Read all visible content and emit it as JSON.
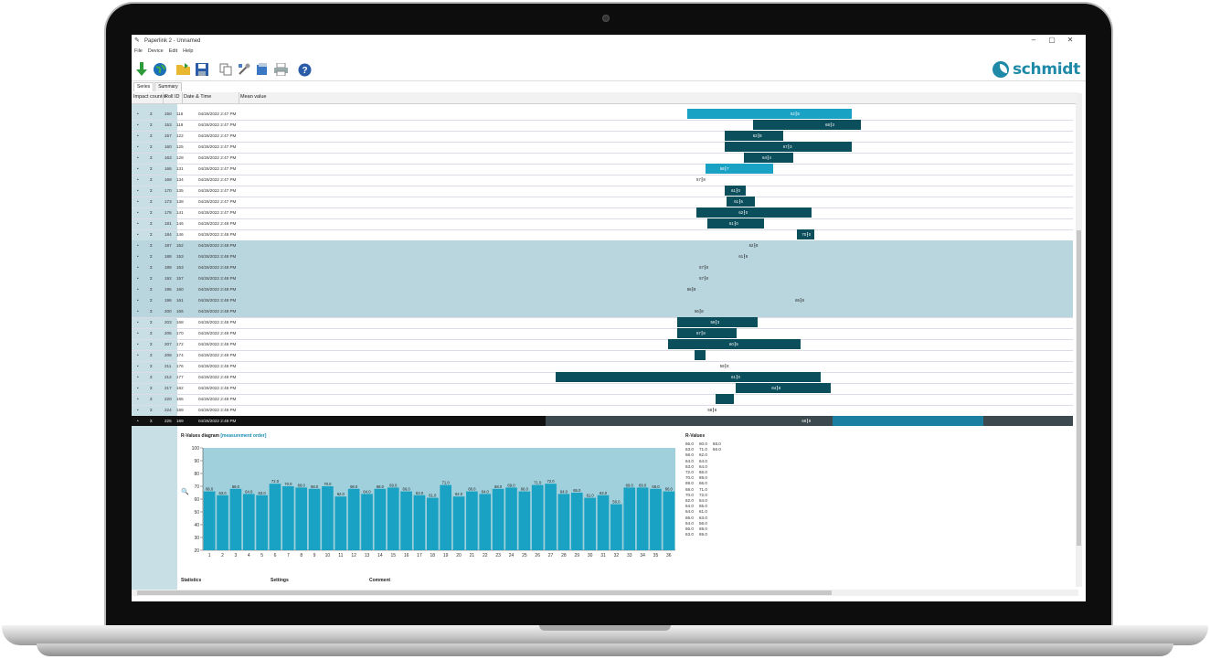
{
  "window": {
    "title": "Paperlink 2 - Unnamed",
    "controls": [
      "–",
      "▢",
      "✕"
    ]
  },
  "menu": [
    "File",
    "Device",
    "Edit",
    "Help"
  ],
  "toolbar_icons": [
    "download-icon",
    "globe-icon",
    "open-folder-icon",
    "save-icon",
    "copy-icon",
    "settings-tools-icon",
    "export-icon",
    "print-icon",
    "help-icon"
  ],
  "brand": {
    "name": "schmidt",
    "color": "#1e8aa8"
  },
  "tabs": [
    "Series",
    "Summary"
  ],
  "columns": [
    "Impact counter",
    "Roll ID",
    "Date & Time",
    "Mean value"
  ],
  "rows": [
    {
      "a": "150",
      "b": "115",
      "dt": "04/26/2022 2:47 PM",
      "bars": [
        {
          "from": 0.59,
          "to": 0.765,
          "tone": "light"
        }
      ],
      "mk": "62.8",
      "mkpos": 0.7
    },
    {
      "a": "153",
      "b": "118",
      "dt": "04/26/2022 2:47 PM",
      "bars": [
        {
          "from": 0.66,
          "to": 0.775,
          "tone": "dark"
        }
      ],
      "mk": "68.3",
      "mkpos": 0.737
    },
    {
      "a": "157",
      "b": "122",
      "dt": "04/26/2022 2:47 PM",
      "bars": [
        {
          "from": 0.63,
          "to": 0.692,
          "tone": "dark"
        }
      ],
      "mk": "62.8",
      "mkpos": 0.66
    },
    {
      "a": "160",
      "b": "125",
      "dt": "04/26/2022 2:47 PM",
      "bars": [
        {
          "from": 0.63,
          "to": 0.765,
          "tone": "dark"
        }
      ],
      "mk": "67.3",
      "mkpos": 0.692
    },
    {
      "a": "163",
      "b": "128",
      "dt": "04/26/2022 2:47 PM",
      "bars": [
        {
          "from": 0.65,
          "to": 0.703,
          "tone": "dark"
        }
      ],
      "mk": "64.4",
      "mkpos": 0.67
    },
    {
      "a": "166",
      "b": "131",
      "dt": "04/26/2022 2:47 PM",
      "bars": [
        {
          "from": 0.61,
          "to": 0.682,
          "tone": "light"
        }
      ],
      "mk": "58.7",
      "mkpos": 0.625
    },
    {
      "a": "169",
      "b": "134",
      "dt": "04/26/2022 2:47 PM",
      "bars": [],
      "mk": "57.8",
      "mkpos": 0.6
    },
    {
      "a": "170",
      "b": "135",
      "dt": "04/26/2022 2:47 PM",
      "bars": [
        {
          "from": 0.63,
          "to": 0.652,
          "tone": "dark"
        }
      ],
      "mk": "61.0",
      "mkpos": 0.637
    },
    {
      "a": "173",
      "b": "138",
      "dt": "04/26/2022 2:47 PM",
      "bars": [
        {
          "from": 0.632,
          "to": 0.662,
          "tone": "dark"
        }
      ],
      "mk": "61.5",
      "mkpos": 0.64
    },
    {
      "a": "176",
      "b": "141",
      "dt": "04/26/2022 2:47 PM",
      "bars": [
        {
          "from": 0.6,
          "to": 0.722,
          "tone": "dark"
        }
      ],
      "mk": "62.0",
      "mkpos": 0.645
    },
    {
      "a": "181",
      "b": "146",
      "dt": "04/26/2022 2:48 PM",
      "bars": [
        {
          "from": 0.612,
          "to": 0.672,
          "tone": "dark"
        }
      ],
      "mk": "61.0",
      "mkpos": 0.635
    },
    {
      "a": "184",
      "b": "146",
      "dt": "04/26/2022 2:48 PM",
      "bars": [
        {
          "from": 0.707,
          "to": 0.725,
          "tone": "dark"
        }
      ],
      "mk": "70.0",
      "mkpos": 0.712
    },
    {
      "a": "187",
      "b": "152",
      "dt": "04/26/2022 2:48 PM",
      "bars": [],
      "mk": "62.8",
      "mkpos": 0.656,
      "sel": true
    },
    {
      "a": "188",
      "b": "153",
      "dt": "04/26/2022 2:48 PM",
      "bars": [],
      "mk": "61.8",
      "mkpos": 0.645,
      "sel": true
    },
    {
      "a": "189",
      "b": "153",
      "dt": "04/26/2022 2:48 PM",
      "bars": [],
      "mk": "57.8",
      "mkpos": 0.603,
      "sel": true
    },
    {
      "a": "192",
      "b": "157",
      "dt": "04/26/2022 2:48 PM",
      "bars": [],
      "mk": "57.8",
      "mkpos": 0.603,
      "sel": true
    },
    {
      "a": "195",
      "b": "160",
      "dt": "04/26/2022 2:48 PM",
      "bars": [],
      "mk": "56.8",
      "mkpos": 0.59,
      "sel": true
    },
    {
      "a": "196",
      "b": "161",
      "dt": "04/26/2022 2:48 PM",
      "bars": [],
      "mk": "65.8",
      "mkpos": 0.705,
      "sel": true
    },
    {
      "a": "200",
      "b": "165",
      "dt": "04/26/2022 2:48 PM",
      "bars": [],
      "mk": "56.8",
      "mkpos": 0.598,
      "sel": true
    },
    {
      "a": "203",
      "b": "168",
      "dt": "04/26/2022 2:48 PM",
      "bars": [
        {
          "from": 0.58,
          "to": 0.665,
          "tone": "dark"
        }
      ],
      "mk": "59.3",
      "mkpos": 0.615
    },
    {
      "a": "205",
      "b": "170",
      "dt": "04/26/2022 2:48 PM",
      "bars": [
        {
          "from": 0.58,
          "to": 0.643,
          "tone": "dark"
        }
      ],
      "mk": "57.8",
      "mkpos": 0.6
    },
    {
      "a": "207",
      "b": "172",
      "dt": "04/26/2022 2:48 PM",
      "bars": [
        {
          "from": 0.57,
          "to": 0.711,
          "tone": "dark"
        }
      ],
      "mk": "60.5",
      "mkpos": 0.635
    },
    {
      "a": "208",
      "b": "174",
      "dt": "04/26/2022 2:48 PM",
      "bars": [
        {
          "from": 0.598,
          "to": 0.61,
          "tone": "dark"
        }
      ],
      "mk": "",
      "mkpos": 0.6
    },
    {
      "a": "211",
      "b": "176",
      "dt": "04/26/2022 2:48 PM",
      "bars": [],
      "mk": "59.8",
      "mkpos": 0.625
    },
    {
      "a": "212",
      "b": "177",
      "dt": "04/26/2022 2:48 PM",
      "bars": [
        {
          "from": 0.45,
          "to": 0.732,
          "tone": "dark"
        }
      ],
      "mk": "61.0",
      "mkpos": 0.637
    },
    {
      "a": "217",
      "b": "182",
      "dt": "04/26/2022 2:48 PM",
      "bars": [
        {
          "from": 0.642,
          "to": 0.743,
          "tone": "dark"
        }
      ],
      "mk": "64.8",
      "mkpos": 0.68
    },
    {
      "a": "220",
      "b": "185",
      "dt": "04/26/2022 2:48 PM",
      "bars": [
        {
          "from": 0.62,
          "to": 0.64,
          "tone": "dark"
        }
      ],
      "mk": "",
      "mkpos": 0.63
    },
    {
      "a": "224",
      "b": "189",
      "dt": "04/26/2022 2:48 PM",
      "bars": [],
      "mk": "58.8",
      "mkpos": 0.612
    },
    {
      "a": "225",
      "b": "189",
      "dt": "04/26/2022 2:48 PM",
      "bars": [],
      "mk": "68.8",
      "mkpos": 0.712,
      "current": true
    }
  ],
  "diagram": {
    "title": "R-Values diagram",
    "subtitle": "[measurement order]"
  },
  "chart_data": {
    "type": "bar",
    "categories": [
      "1",
      "2",
      "3",
      "4",
      "5",
      "6",
      "7",
      "8",
      "9",
      "10",
      "11",
      "12",
      "13",
      "14",
      "15",
      "16",
      "17",
      "18",
      "19",
      "20",
      "21",
      "22",
      "23",
      "24",
      "25",
      "26",
      "27",
      "28",
      "29",
      "30",
      "31",
      "32",
      "33",
      "34",
      "35",
      "36"
    ],
    "values": [
      66.0,
      63.0,
      68.0,
      64.0,
      63.0,
      72.0,
      70.0,
      69.0,
      68.0,
      70.0,
      62.0,
      68.0,
      64.0,
      68.0,
      69.0,
      66.0,
      63.0,
      61.0,
      71.0,
      62.0,
      66.0,
      64.0,
      68.0,
      69.0,
      66.0,
      71.0,
      72.0,
      64.0,
      65.0,
      61.0,
      63.0,
      56.0,
      69.0,
      69.0,
      68.0,
      66.0
    ],
    "ylim": [
      20,
      100
    ],
    "yticks": [
      20,
      30,
      40,
      50,
      60,
      70,
      80,
      90,
      100
    ],
    "bar_color": "#1aa2c4",
    "band_color": "#9fd0dc",
    "grid": false,
    "title": "R-Values diagram",
    "xlabel": "",
    "ylabel": ""
  },
  "rvalues": {
    "title": "R-Values",
    "rows": [
      [
        "66.0",
        "60.0",
        "68.0"
      ],
      [
        "63.0",
        "71.0",
        "66.0"
      ],
      [
        "68.0",
        "62.0",
        ""
      ],
      [
        "64.0",
        "64.0",
        ""
      ],
      [
        "63.0",
        "64.0",
        ""
      ],
      [
        "72.0",
        "66.0",
        ""
      ],
      [
        "70.0",
        "69.0",
        ""
      ],
      [
        "69.0",
        "66.0",
        ""
      ],
      [
        "68.0",
        "71.0",
        ""
      ],
      [
        "70.0",
        "72.0",
        ""
      ],
      [
        "62.0",
        "64.0",
        ""
      ],
      [
        "64.0",
        "65.0",
        ""
      ],
      [
        "64.0",
        "61.0",
        ""
      ],
      [
        "66.0",
        "63.0",
        ""
      ],
      [
        "64.0",
        "56.0",
        ""
      ],
      [
        "66.0",
        "69.0",
        ""
      ],
      [
        "63.0",
        "69.0",
        ""
      ]
    ]
  },
  "footer": [
    "Statistics",
    "Settings",
    "Comment"
  ]
}
